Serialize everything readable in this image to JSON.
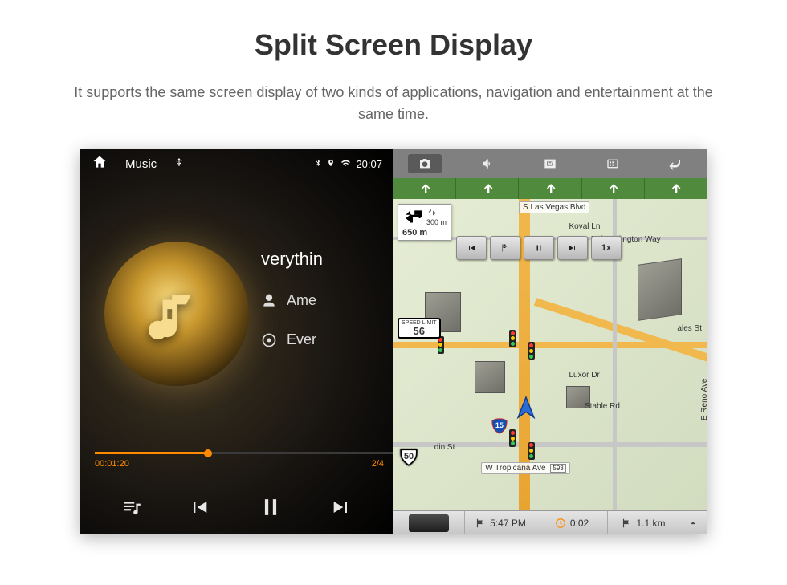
{
  "page": {
    "title": "Split Screen Display",
    "subtitle": "It supports the same screen display of two kinds of applications, navigation and entertainment at the same time."
  },
  "statusbar": {
    "app_label": "Music",
    "clock": "20:07"
  },
  "music": {
    "tracks": {
      "prev_partial": "verythin",
      "current": "Ame",
      "next": "Ever"
    },
    "time_current": "00:01:20",
    "track_counter": "2/4"
  },
  "nav": {
    "top_street": "S Las Vegas Blvd",
    "turn_sub_dist": "300 m",
    "turn_main_dist": "650 m",
    "playback_speed": "1x",
    "speed_limit_label": "SPEED LIMIT",
    "speed_limit_value": "56",
    "route_shield": "50",
    "streets": {
      "koval": "Koval Ln",
      "duke": "Duke Ellington Way",
      "ales": "ales St",
      "vegas_blvd": "Vegas Blvd",
      "reno": "E Reno Ave",
      "luxor": "Luxor Dr",
      "stable": "Stable Rd",
      "tropicana": "W Tropicana Ave",
      "tropicana_num": "593",
      "din": "din St"
    },
    "footer": {
      "eta": "5:47 PM",
      "remaining_time": "0:02",
      "remaining_dist": "1.1 km"
    },
    "interstate": "15"
  }
}
